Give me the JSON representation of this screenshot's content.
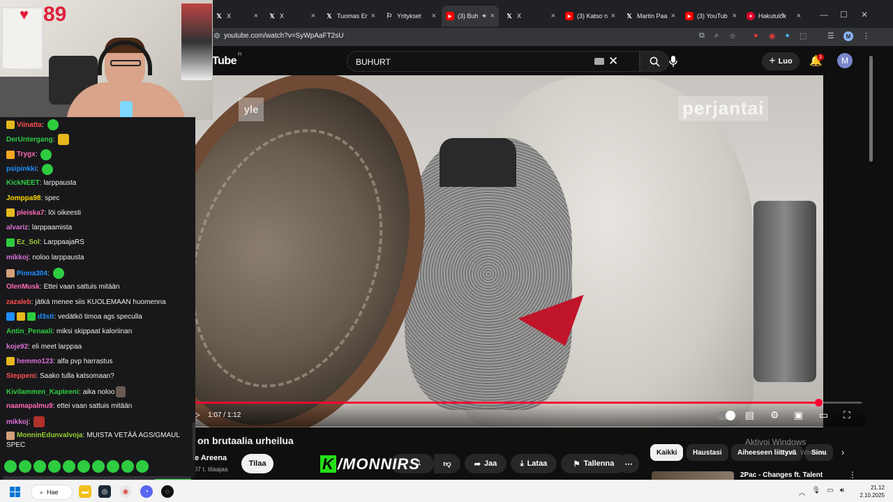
{
  "browser": {
    "tabs": [
      {
        "icon": "x-logo-icon",
        "label": "X",
        "active": false
      },
      {
        "icon": "x-logo-icon",
        "label": "X",
        "active": false
      },
      {
        "icon": "x-logo-icon",
        "label": "Tuomas Er",
        "active": false
      },
      {
        "icon": "yritykset-icon",
        "label": "Yritykset",
        "active": false
      },
      {
        "icon": "youtube-icon",
        "label": "(3) Buh",
        "active": true
      },
      {
        "icon": "x-logo-icon",
        "label": "X",
        "active": false
      },
      {
        "icon": "youtube-icon",
        "label": "(3) Katso n",
        "active": false
      },
      {
        "icon": "x-logo-icon",
        "label": "Martin Paa",
        "active": false
      },
      {
        "icon": "youtube-icon",
        "label": "(3) YouTub",
        "active": false
      },
      {
        "icon": "hakutulokset-icon",
        "label": "Hakutulok",
        "active": false
      }
    ],
    "url": "youtube.com/watch?v=SyWpAaFT2sU"
  },
  "youtube": {
    "logo_text": "Tube",
    "logo_region": "FI",
    "search_value": "BUHURT",
    "create_label": "Luo",
    "notification_count": "3",
    "avatar_letter": "M"
  },
  "video": {
    "watermark_left": "yle",
    "watermark_right": "perjantai",
    "watermark_corner": "yle",
    "current_time": "1:07",
    "duration": "1:12",
    "time_display": "1:07 / 1:12",
    "progress": 0.935,
    "title": "on brutaalia urheilua",
    "channel": "le Areena",
    "subscribers": "07 t. tilaajaa",
    "subscribe_label": "Tilaa",
    "like_count": "1",
    "share_label": "Jaa",
    "download_label": "Lataa",
    "save_label": "Tallenna"
  },
  "overlay": {
    "logo_k": "K",
    "logo_text": "/MONNIRS"
  },
  "sidebar": {
    "chips": [
      "Kaikki",
      "Haustasi",
      "Aiheeseen liittyvä",
      "Sinu"
    ],
    "recommended_title": "2Pac - Changes ft. Talent"
  },
  "activation": {
    "title": "Aktivoi Windows",
    "subtitle": "ä akt... Windows."
  },
  "stream": {
    "heart_rate": "89"
  },
  "chat": {
    "messages": [
      {
        "user": "Viinatta",
        "color": "#ff4f4f",
        "text": "",
        "badge": "gold",
        "emote": "green"
      },
      {
        "user": "DerUntergang",
        "color": "#2ecc40",
        "text": "",
        "badge": "",
        "emote": "gold"
      },
      {
        "user": "Trygx",
        "color": "#ff69b4",
        "text": "",
        "badge": "crown",
        "emote": "green"
      },
      {
        "user": "psipinkki",
        "color": "#1e90ff",
        "text": "",
        "badge": "",
        "emote": "green"
      },
      {
        "user": "KickNEET",
        "color": "#2ecc40",
        "text": "larppausta",
        "badge": "",
        "emote": ""
      },
      {
        "user": "Jomppa98",
        "color": "#ffd700",
        "text": "spec",
        "badge": "",
        "emote": ""
      },
      {
        "user": "pleiska7",
        "color": "#ff69b4",
        "text": "löi oikeesti",
        "badge": "gold",
        "emote": ""
      },
      {
        "user": "alvariz",
        "color": "#da70d6",
        "text": "larppaamista",
        "badge": "",
        "emote": ""
      },
      {
        "user": "Ez_Sol",
        "color": "#9acd32",
        "text": "LarppaajaRS",
        "badge": "green",
        "emote": ""
      },
      {
        "user": "mikkoj",
        "color": "#da70d6",
        "text": "noloo larppausta",
        "badge": "",
        "emote": ""
      },
      {
        "user": "Pinna304",
        "color": "#1e90ff",
        "text": "",
        "badge": "hand",
        "emote": "green"
      },
      {
        "user": "OlenMusk",
        "color": "#ff69b4",
        "text": "Ettei vaan sattuis mitään",
        "badge": "",
        "emote": ""
      },
      {
        "user": "zazaleb",
        "color": "#ff4f4f",
        "text": "jätkä menee siis KUOLEMAAN huomenna",
        "badge": "",
        "emote": ""
      },
      {
        "user": "d3sti",
        "color": "#1e90ff",
        "text": "vedätkö timoa ags specullа",
        "badge": "multi",
        "emote": ""
      },
      {
        "user": "Antin_Penaali",
        "color": "#2ecc40",
        "text": "miksi skippaat kaloriinan",
        "badge": "",
        "emote": ""
      },
      {
        "user": "koje92",
        "color": "#da70d6",
        "text": "eli meet larppaa",
        "badge": "",
        "emote": ""
      },
      {
        "user": "hemmo123",
        "color": "#da70d6",
        "text": "alfa pvp harrastus",
        "badge": "gold",
        "emote": ""
      },
      {
        "user": "Steppeni",
        "color": "#ff4f4f",
        "text": "Saako tulla katsomaan?",
        "badge": "",
        "emote": ""
      },
      {
        "user": "Kivilammen_Kapteeni",
        "color": "#2ecc40",
        "text": "aika noloo",
        "badge": "",
        "emote": "dark"
      },
      {
        "user": "naamapalmu9",
        "color": "#ff69b4",
        "text": "ettei vaan sattuis mitään",
        "badge": "",
        "emote": ""
      },
      {
        "user": "mikkoj",
        "color": "#da70d6",
        "text": "",
        "badge": "",
        "emote": "red"
      },
      {
        "user": "MonninEdunvalvoja",
        "color": "#9acd32",
        "text": "MUISTA VETÄÄ AGS/GMAUL",
        "text2": "SPEC",
        "badge": "hand",
        "emote": ""
      }
    ]
  },
  "taskbar": {
    "search_label": "Hae",
    "time": "21.12",
    "date": "2.10.2025"
  },
  "colors": {
    "youtube_red": "#ff0033",
    "kick_green": "#26e018",
    "chat_bg": "#18181b"
  }
}
